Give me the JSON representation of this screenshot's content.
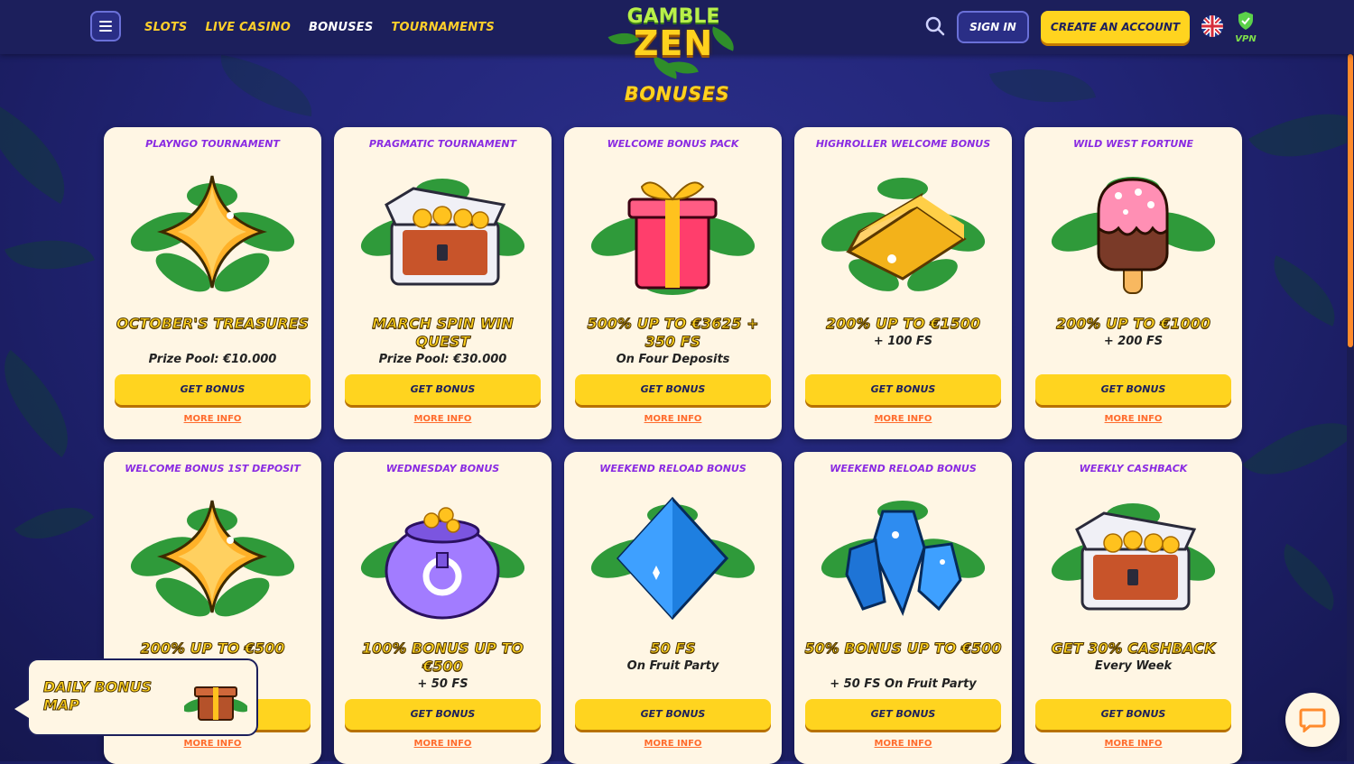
{
  "header": {
    "nav": [
      {
        "label": "SLOTS",
        "active": false
      },
      {
        "label": "LIVE CASINO",
        "active": false
      },
      {
        "label": "BONUSES",
        "active": true
      },
      {
        "label": "TOURNAMENTS",
        "active": false
      }
    ],
    "logo_line1": "GAMBLE",
    "logo_line2": "ZEN",
    "signin_label": "SIGN IN",
    "create_account_label": "CREATE AN ACCOUNT",
    "vpn_label": "VPN"
  },
  "page_title": "BONUSES",
  "cards": [
    {
      "category": "PLAYNGO TOURNAMENT",
      "headline": "OCTOBER'S TREASURES",
      "sub": "Prize Pool: €10.000",
      "button": "GET BONUS",
      "more": "MORE INFO",
      "icon": "star-gem-icon"
    },
    {
      "category": "PRAGMATIC TOURNAMENT",
      "headline": "MARCH SPIN WIN QUEST",
      "sub": "Prize Pool: €30.000",
      "button": "GET BONUS",
      "more": "MORE INFO",
      "icon": "treasure-chest-icon"
    },
    {
      "category": "WELCOME BONUS PACK",
      "headline": "500% UP TO €3625 + 350 FS",
      "sub": "On Four Deposits",
      "button": "GET BONUS",
      "more": "MORE INFO",
      "icon": "gift-box-icon"
    },
    {
      "category": "HIGHROLLER WELCOME BONUS",
      "headline": "200% UP TO €1500",
      "sub": "+ 100 FS",
      "button": "GET BONUS",
      "more": "MORE INFO",
      "icon": "gold-bar-icon"
    },
    {
      "category": "WILD WEST FORTUNE",
      "headline": "200% UP TO €1000",
      "sub": "+ 200 FS",
      "button": "GET BONUS",
      "more": "MORE INFO",
      "icon": "ice-cream-icon"
    },
    {
      "category": "WELCOME BONUS 1ST DEPOSIT",
      "headline": "200% UP TO €500",
      "sub": "",
      "button": "GET BONUS",
      "more": "MORE INFO",
      "icon": "star-gem-icon"
    },
    {
      "category": "WEDNESDAY BONUS",
      "headline": "100% BONUS UP TO €500",
      "sub": "+ 50 FS",
      "button": "GET BONUS",
      "more": "MORE INFO",
      "icon": "coin-pot-icon"
    },
    {
      "category": "WEEKEND RELOAD BONUS",
      "headline": "50 FS",
      "sub": "On Fruit Party",
      "button": "GET BONUS",
      "more": "MORE INFO",
      "icon": "blue-diamond-icon"
    },
    {
      "category": "WEEKEND RELOAD BONUS",
      "headline": "50% BONUS UP TO €500",
      "sub": "+ 50 FS On Fruit Party",
      "button": "GET BONUS",
      "more": "MORE INFO",
      "icon": "blue-crystals-icon"
    },
    {
      "category": "WEEKLY CASHBACK",
      "headline": "GET 30% CASHBACK",
      "sub": "Every Week",
      "button": "GET BONUS",
      "more": "MORE INFO",
      "icon": "treasure-chest-icon"
    }
  ],
  "daily_bonus": {
    "label": "DAILY BONUS MAP",
    "icon": "gift-box-icon"
  },
  "chat": {
    "icon": "chat-bubble-icon"
  },
  "colors": {
    "accent": "#ffd21e",
    "category": "#8a2be2",
    "more_info": "#ff6b2c",
    "header_bg": "#1c1f5c"
  }
}
